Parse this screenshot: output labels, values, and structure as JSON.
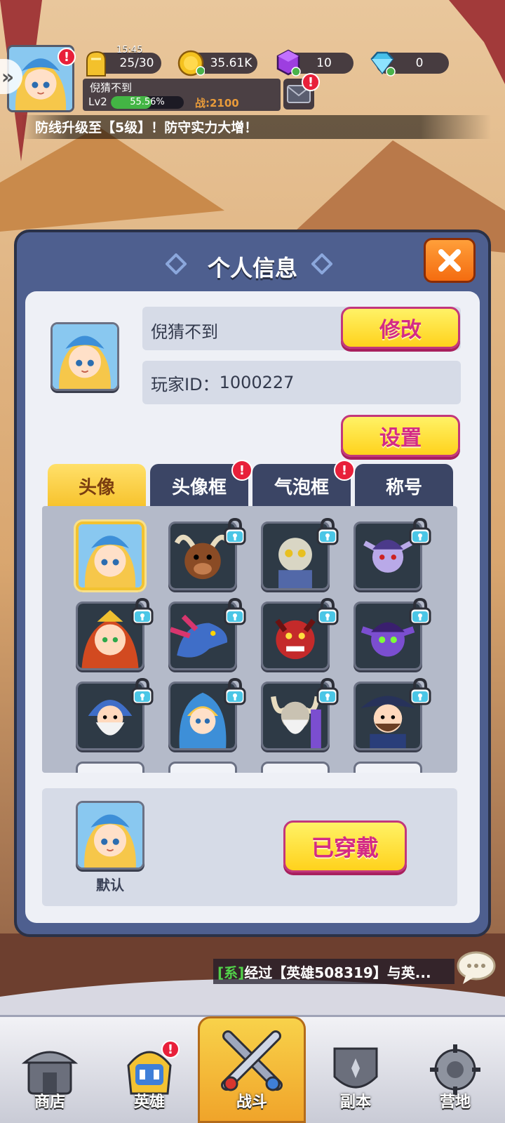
{
  "hud": {
    "time": "15:45",
    "stamina": "25/30",
    "gold": "35.61K",
    "gems": "10",
    "diamonds": "0",
    "player_name": "倪猜不到",
    "level": "Lv2",
    "exp_percent": "55.56%",
    "exp_fraction": 0.5556,
    "power": "战:2100",
    "alert": "!"
  },
  "notice": "防线升级至【5级】！防守实力大增！",
  "dialog": {
    "title": "个人信息",
    "name_value": "倪猜不到",
    "edit_label": "修改",
    "player_id_label": "玩家ID：",
    "player_id": "1000227",
    "settings_label": "设置",
    "tabs": [
      {
        "label": "头像",
        "active": true,
        "alert": false
      },
      {
        "label": "头像框",
        "active": false,
        "alert": true
      },
      {
        "label": "气泡框",
        "active": false,
        "alert": true
      },
      {
        "label": "称号",
        "active": false,
        "alert": false
      }
    ],
    "avatars": [
      {
        "icon": "blonde-mage-girl-icon",
        "locked": false,
        "selected": true
      },
      {
        "icon": "minotaur-icon",
        "locked": true
      },
      {
        "icon": "skeleton-warrior-icon",
        "locked": true
      },
      {
        "icon": "dark-elf-icon",
        "locked": true
      },
      {
        "icon": "fire-elf-girl-icon",
        "locked": true
      },
      {
        "icon": "blue-dragon-icon",
        "locked": true
      },
      {
        "icon": "red-demon-icon",
        "locked": true
      },
      {
        "icon": "purple-goblin-icon",
        "locked": true
      },
      {
        "icon": "old-wizard-icon",
        "locked": true
      },
      {
        "icon": "blue-hood-girl-icon",
        "locked": true
      },
      {
        "icon": "horned-elder-icon",
        "locked": true
      },
      {
        "icon": "pirate-captain-icon",
        "locked": true
      }
    ],
    "preview_label": "默认",
    "equipped_label": "已穿戴"
  },
  "chat": {
    "tag": "[系]",
    "message": "经过【英雄508319】与英..."
  },
  "nav": [
    {
      "label": "商店",
      "icon": "shop-icon",
      "alert": false
    },
    {
      "label": "英雄",
      "icon": "hero-icon",
      "alert": true
    },
    {
      "label": "战斗",
      "icon": "battle-swords-icon",
      "alert": false,
      "active": true
    },
    {
      "label": "副本",
      "icon": "dungeon-icon",
      "alert": false
    },
    {
      "label": "营地",
      "icon": "camp-icon",
      "alert": false
    }
  ]
}
